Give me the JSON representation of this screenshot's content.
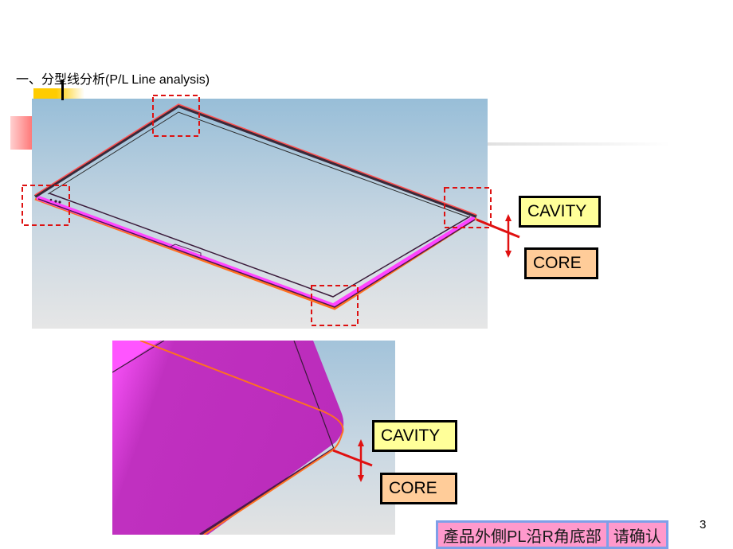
{
  "slide": {
    "title": "一、分型线分析(P/L Line  analysis)",
    "page_number": "3"
  },
  "colors": {
    "part_magenta": "#ff44ff",
    "part_dark_magenta": "#c030c0",
    "parting_line_orange": "#ff7020",
    "highlight_red": "#dd1111",
    "cavity_fill": "#ffff99",
    "core_fill": "#ffcc99",
    "note_fill": "#ff99cc",
    "note_border": "#7f9fe8"
  },
  "overview_view": {
    "description": "isometric frame part with parting line",
    "highlight_boxes_count": 4,
    "labels": {
      "cavity": "CAVITY",
      "core": "CORE"
    }
  },
  "detail_view": {
    "description": "corner close-up showing parting line along R corner bottom",
    "labels": {
      "cavity": "CAVITY",
      "core": "CORE"
    }
  },
  "note": {
    "statement": "產品外側PL沿R角底部",
    "action": "请确认"
  }
}
